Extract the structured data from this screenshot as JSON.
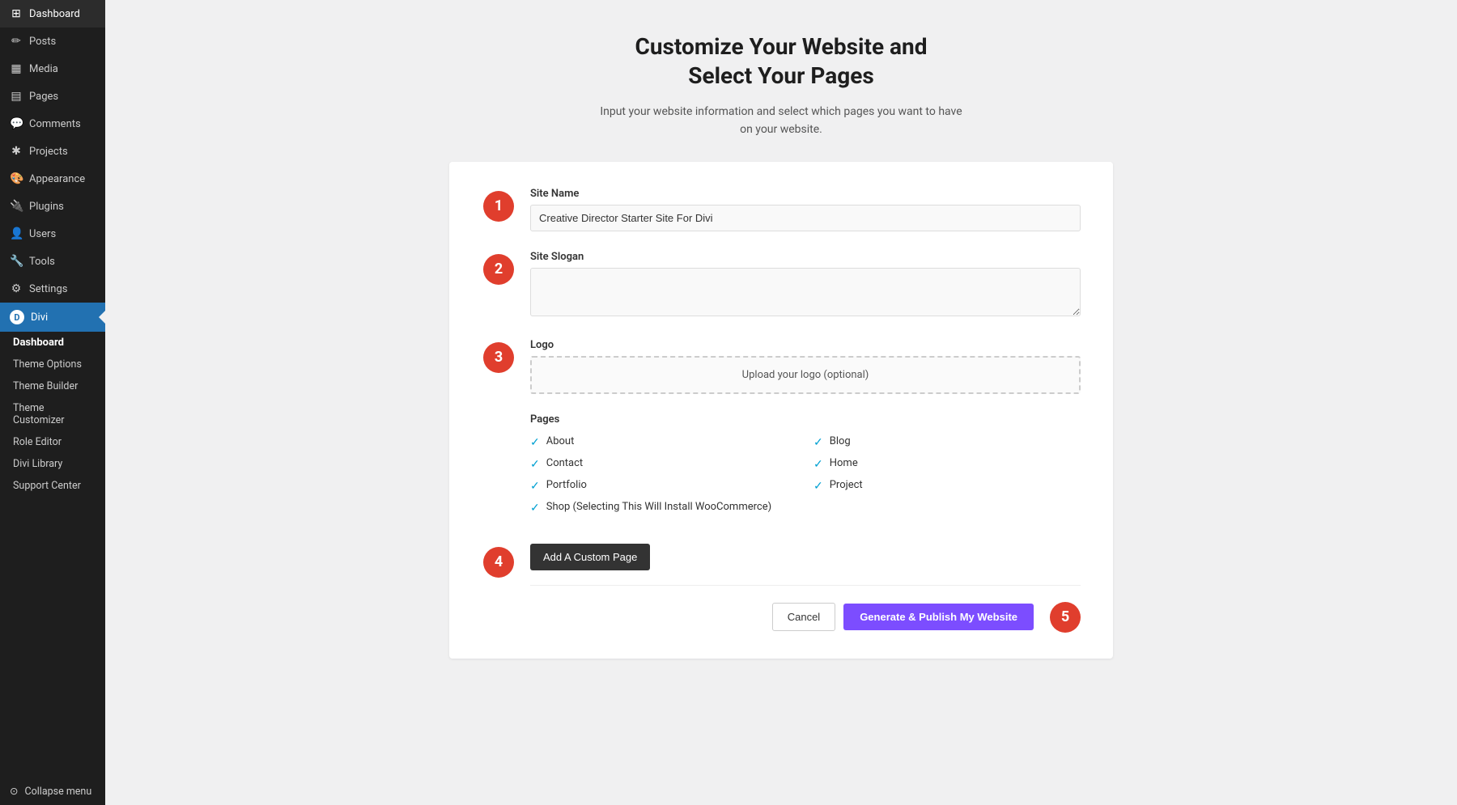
{
  "sidebar": {
    "items": [
      {
        "label": "Dashboard",
        "icon": "⊞"
      },
      {
        "label": "Posts",
        "icon": "✎"
      },
      {
        "label": "Media",
        "icon": "▦"
      },
      {
        "label": "Pages",
        "icon": "▤"
      },
      {
        "label": "Comments",
        "icon": "💬"
      },
      {
        "label": "Projects",
        "icon": "✱"
      },
      {
        "label": "Appearance",
        "icon": "🎨"
      },
      {
        "label": "Plugins",
        "icon": "🔌"
      },
      {
        "label": "Users",
        "icon": "👤"
      },
      {
        "label": "Tools",
        "icon": "🔧"
      },
      {
        "label": "Settings",
        "icon": "⚙"
      }
    ],
    "divi": {
      "label": "Divi",
      "icon": "D",
      "submenu": [
        {
          "label": "Dashboard",
          "bold": true
        },
        {
          "label": "Theme Options"
        },
        {
          "label": "Theme Builder"
        },
        {
          "label": "Theme Customizer"
        },
        {
          "label": "Role Editor"
        },
        {
          "label": "Divi Library"
        },
        {
          "label": "Support Center"
        }
      ]
    },
    "collapse_label": "Collapse menu"
  },
  "page": {
    "title": "Customize Your Website and\nSelect Your Pages",
    "subtitle": "Input your website information and select which pages you want to have\non your website."
  },
  "form": {
    "site_name_label": "Site Name",
    "site_name_value": "Creative Director Starter Site For Divi",
    "site_slogan_label": "Site Slogan",
    "site_slogan_placeholder": "",
    "logo_label": "Logo",
    "logo_upload_text": "Upload your logo (optional)",
    "pages_label": "Pages",
    "pages": [
      {
        "label": "About",
        "checked": true
      },
      {
        "label": "Blog",
        "checked": true
      },
      {
        "label": "Contact",
        "checked": true
      },
      {
        "label": "Home",
        "checked": true
      },
      {
        "label": "Portfolio",
        "checked": true
      },
      {
        "label": "Project",
        "checked": true
      },
      {
        "label": "Shop (Selecting This Will Install WooCommerce)",
        "checked": true
      }
    ],
    "add_custom_label": "Add A Custom Page",
    "cancel_label": "Cancel",
    "publish_label": "Generate & Publish My Website"
  },
  "steps": [
    "1",
    "2",
    "3",
    "4",
    "5"
  ],
  "icons": {
    "check": "✓",
    "collapse": "⊙"
  }
}
